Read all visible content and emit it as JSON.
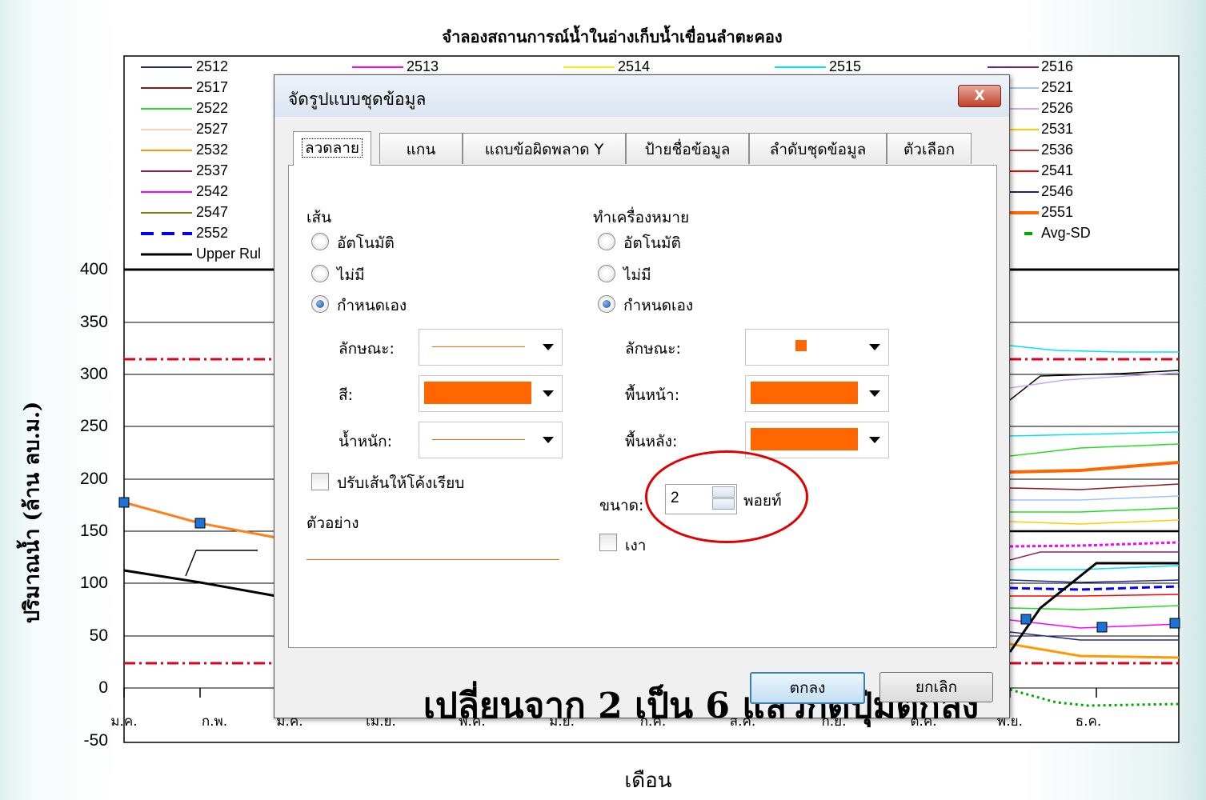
{
  "chart": {
    "title": "จำลองสถานการณ์น้ำในอ่างเก็บน้ำเขื่อนลำตะคอง",
    "y_axis_label": "ปริมาณน้ำ (ล้าน ลบ.ม.)",
    "x_axis_label": "เดือน",
    "y_ticks": [
      "400",
      "350",
      "300",
      "250",
      "200",
      "150",
      "100",
      "50",
      "0",
      "-50"
    ],
    "x_ticks": [
      "ม.ค.",
      "ก.พ.",
      "มี.ค.",
      "เม.ย.",
      "พ.ค.",
      "มิ.ย.",
      "ก.ค.",
      "ส.ค.",
      "ก.ย.",
      "ต.ค.",
      "พ.ย.",
      "ธ.ค."
    ],
    "legend": [
      {
        "label": "2512",
        "color": "#1f2a8a",
        "style": "solid"
      },
      {
        "label": "2513",
        "color": "#ff00ff",
        "style": "solid"
      },
      {
        "label": "2514",
        "color": "#ffee00",
        "style": "solid"
      },
      {
        "label": "2515",
        "color": "#00e5ee",
        "style": "solid"
      },
      {
        "label": "2516",
        "color": "#7b1e7b",
        "style": "solid"
      },
      {
        "label": "2517",
        "color": "#8b1a1a",
        "style": "solid"
      },
      {
        "label": "2521",
        "color": "#9fc3ff",
        "style": "solid"
      },
      {
        "label": "2522",
        "color": "#22dd22",
        "style": "solid"
      },
      {
        "label": "2526",
        "color": "#c7a4ff",
        "style": "solid"
      },
      {
        "label": "2527",
        "color": "#ffd2b0",
        "style": "solid"
      },
      {
        "label": "2531",
        "color": "#ffcc00",
        "style": "solid"
      },
      {
        "label": "2532",
        "color": "#ff9900",
        "style": "solid"
      },
      {
        "label": "2536",
        "color": "#c0392b",
        "style": "solid"
      },
      {
        "label": "2537",
        "color": "#8e2060",
        "style": "solid"
      },
      {
        "label": "2541",
        "color": "#ff0000",
        "style": "solid"
      },
      {
        "label": "2542",
        "color": "#ff00ff",
        "style": "solid"
      },
      {
        "label": "2546",
        "color": "#1a237e",
        "style": "solid"
      },
      {
        "label": "2547",
        "color": "#808000",
        "style": "solid"
      },
      {
        "label": "2551",
        "color": "#ff6600",
        "style": "thick"
      },
      {
        "label": "2552",
        "color": "#0000ff",
        "style": "dashed"
      },
      {
        "label": "Avg-SD",
        "color": "#00aa00",
        "style": "dotted"
      },
      {
        "label": "Upper Rul",
        "color": "#000000",
        "style": "thick"
      }
    ]
  },
  "dialog": {
    "title": "จัดรูปแบบชุดข้อมูล",
    "close_label": "X",
    "tabs": [
      "ลวดลาย",
      "แกน",
      "แถบข้อผิดพลาด Y",
      "ป้ายชื่อข้อมูล",
      "ลำดับชุดข้อมูล",
      "ตัวเลือก"
    ],
    "line_section": {
      "heading": "เส้น",
      "options": [
        "อัตโนมัติ",
        "ไม่มี",
        "กำหนดเอง"
      ],
      "selected": "กำหนดเอง",
      "style_label": "ลักษณะ:",
      "color_label": "สี:",
      "weight_label": "น้ำหนัก:",
      "color": "#ff6600",
      "smooth_label": "ปรับเส้นให้โค้งเรียบ",
      "sample_label": "ตัวอย่าง"
    },
    "marker_section": {
      "heading": "ทำเครื่องหมาย",
      "options": [
        "อัตโนมัติ",
        "ไม่มี",
        "กำหนดเอง"
      ],
      "selected": "กำหนดเอง",
      "style_label": "ลักษณะ:",
      "foreground_label": "พื้นหน้า:",
      "background_label": "พื้นหลัง:",
      "color": "#ff6600",
      "size_label": "ขนาด:",
      "size_value": "2",
      "size_unit": "พอยท์",
      "shadow_label": "เงา"
    },
    "ok_label": "ตกลง",
    "cancel_label": "ยกเลิก"
  },
  "annotation": "เปลี่ยนจาก 2 เป็น 6 แล้วกดปุ่มตกลง"
}
